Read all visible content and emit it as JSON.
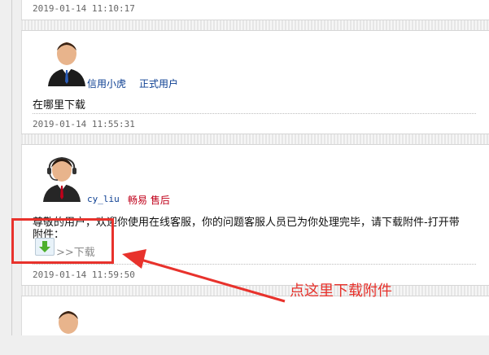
{
  "post1": {
    "timestamp": "2019-01-14 11:10:17"
  },
  "post2": {
    "user": "信用小虎",
    "role": "正式用户",
    "content": "在哪里下载",
    "timestamp": "2019-01-14 11:55:31"
  },
  "post3": {
    "user": "cy_liu",
    "role": "畅易 售后",
    "content": "尊敬的用户，欢迎你使用在线客服，你的问题客服人员已为你处理完毕，请下载附件-打开带",
    "attachment_label": "附件：",
    "download_link": ">>下载",
    "timestamp": "2019-01-14 11:59:50"
  },
  "annotation": {
    "text": "点这里下载附件"
  },
  "colors": {
    "link": "#0a3d91",
    "staff_red": "#c0001a",
    "annotation_red": "#e8322c"
  }
}
